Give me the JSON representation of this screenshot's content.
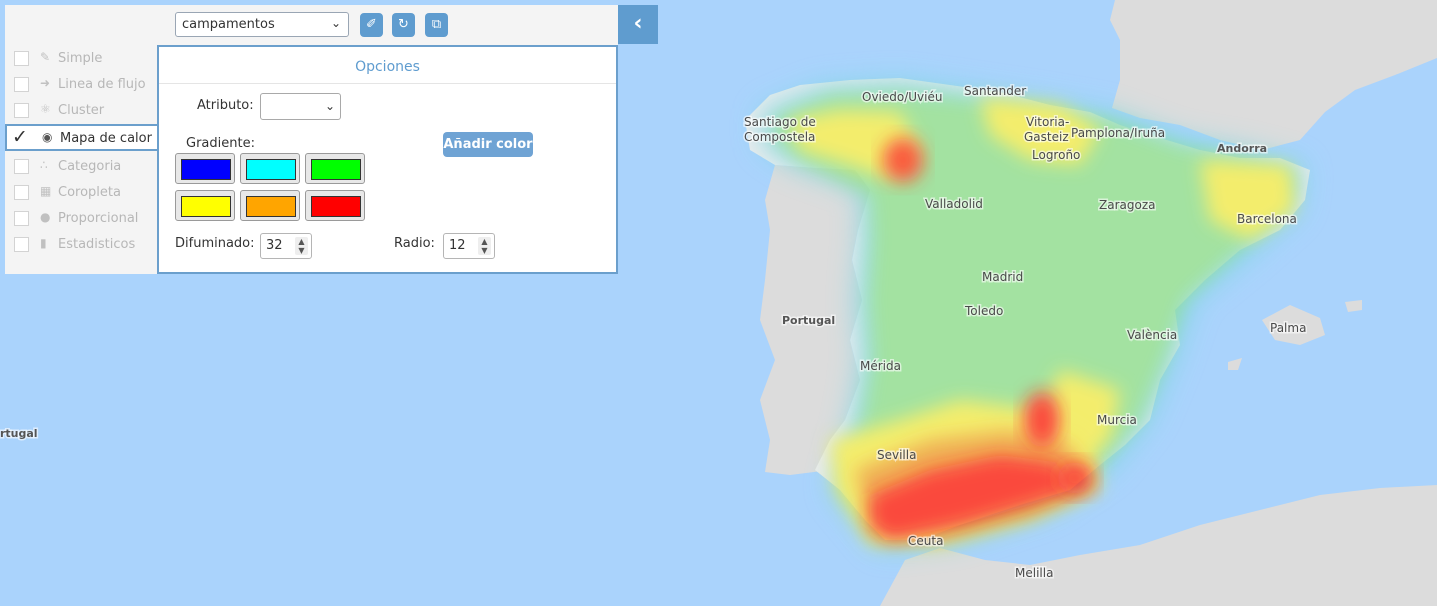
{
  "map": {
    "labels": [
      {
        "text": "Oviedo/Uviéu",
        "bold": false
      },
      {
        "text": "Santander",
        "bold": false
      },
      {
        "text": "Santiago de",
        "bold": false
      },
      {
        "text": "Compostela",
        "bold": false
      },
      {
        "text": "Vitoria-",
        "bold": false
      },
      {
        "text": "Gasteiz",
        "bold": false
      },
      {
        "text": "Pamplona/Iruña",
        "bold": false
      },
      {
        "text": "Logroño",
        "bold": false
      },
      {
        "text": "Andorra",
        "bold": true
      },
      {
        "text": "Valladolid",
        "bold": false
      },
      {
        "text": "Zaragoza",
        "bold": false
      },
      {
        "text": "Barcelona",
        "bold": false
      },
      {
        "text": "Madrid",
        "bold": false
      },
      {
        "text": "Portugal",
        "bold": true
      },
      {
        "text": "Toledo",
        "bold": false
      },
      {
        "text": "València",
        "bold": false
      },
      {
        "text": "Palma",
        "bold": false
      },
      {
        "text": "Mérida",
        "bold": false
      },
      {
        "text": "Murcia",
        "bold": false
      },
      {
        "text": "Sevilla",
        "bold": false
      },
      {
        "text": "Ceuta",
        "bold": false
      },
      {
        "text": "Melilla",
        "bold": false
      },
      {
        "text": "rtugal",
        "bold": true
      }
    ]
  },
  "toolbar": {
    "layer_value": "campamentos",
    "icons": [
      "brush-icon",
      "refresh-icon",
      "copy-icon"
    ],
    "collapse_icon": "chevron-left-icon"
  },
  "sidebar": {
    "items": [
      {
        "label": "Simple",
        "icon": "simple-icon",
        "active": false
      },
      {
        "label": "Linea de flujo",
        "icon": "arrow-right-icon",
        "active": false
      },
      {
        "label": "Cluster",
        "icon": "cluster-icon",
        "active": false
      },
      {
        "label": "Mapa de calor",
        "icon": "heatmap-icon",
        "active": true
      },
      {
        "label": "Categoria",
        "icon": "category-icon",
        "active": false
      },
      {
        "label": "Coropleta",
        "icon": "choropleth-icon",
        "active": false
      },
      {
        "label": "Proporcional",
        "icon": "proportional-icon",
        "active": false
      },
      {
        "label": "Estadisticos",
        "icon": "statistics-icon",
        "active": false
      }
    ]
  },
  "options": {
    "title": "Opciones",
    "attribute_label": "Atributo:",
    "attribute_value": "",
    "gradient_label": "Gradiente:",
    "add_color_label": "Añadir color",
    "gradient_colors": [
      "#0000ff",
      "#00ffff",
      "#00ff00",
      "#ffff00",
      "#ffa500",
      "#ff0000"
    ],
    "blur_label": "Difuminado:",
    "blur_value": "32",
    "radius_label": "Radio:",
    "radius_value": "12"
  }
}
